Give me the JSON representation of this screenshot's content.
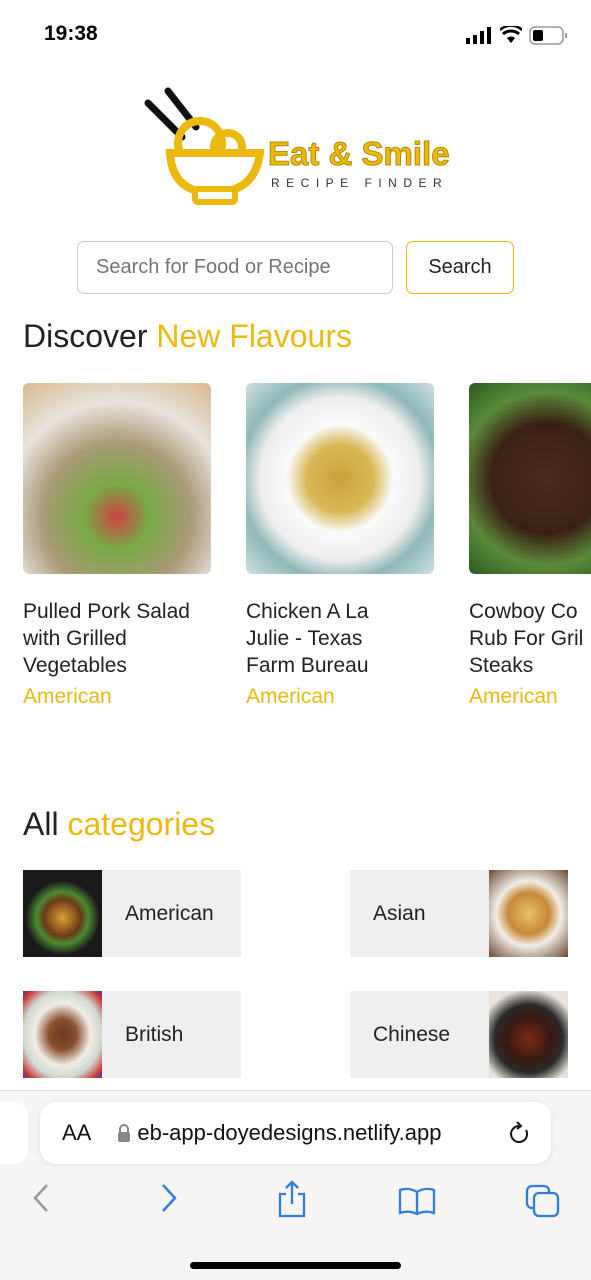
{
  "status": {
    "time": "19:38"
  },
  "logo": {
    "title": "Eat & Smile",
    "subtitle": "RECIPE FINDER"
  },
  "search": {
    "placeholder": "Search for Food or Recipe",
    "button": "Search"
  },
  "discover": {
    "heading_plain": "Discover",
    "heading_accent": "New Flavours",
    "cards": [
      {
        "title": "Pulled Pork Salad with Grilled Vegetables",
        "lines": [
          "Pulled Pork Salad",
          "with Grilled",
          "Vegetables"
        ],
        "cuisine": "American"
      },
      {
        "title": "Chicken A La Julie - Texas Farm Bureau",
        "lines": [
          "Chicken A La",
          "Julie - Texas",
          "Farm Bureau"
        ],
        "cuisine": "American"
      },
      {
        "title": "Cowboy Coffee Rub For Grilled Steaks",
        "lines": [
          "Cowboy Co",
          "Rub For Gril",
          "Steaks"
        ],
        "cuisine": "American"
      }
    ]
  },
  "categories": {
    "heading_plain": "All",
    "heading_accent": "categories",
    "items": [
      {
        "label": "American"
      },
      {
        "label": "Asian"
      },
      {
        "label": "British"
      },
      {
        "label": "Chinese"
      }
    ]
  },
  "browser": {
    "text_size": "AA",
    "url": "eb-app-doyedesigns.netlify.app"
  },
  "colors": {
    "accent": "#ecb90f",
    "ios_blue": "#2f7de1"
  }
}
